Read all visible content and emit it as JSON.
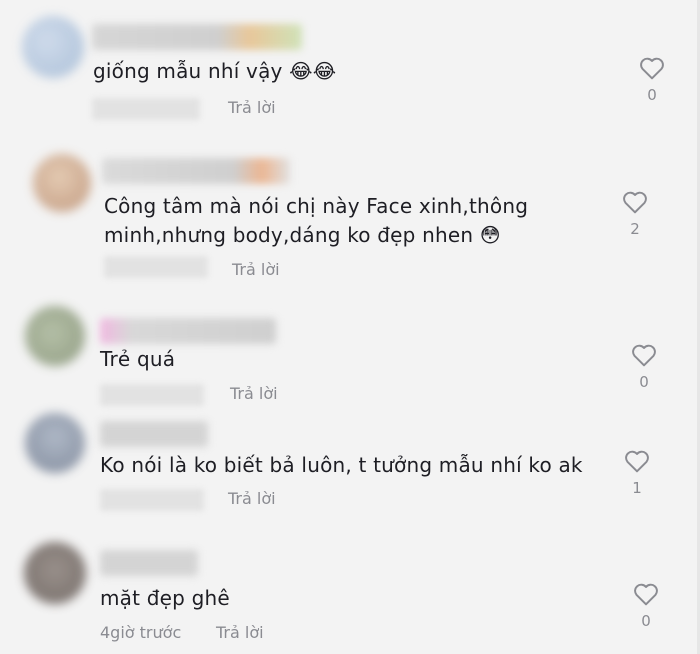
{
  "comments": [
    {
      "text": "giống mẫu nhí vậy 😂😂",
      "time": "",
      "reply": "Trả lời",
      "likes": "0"
    },
    {
      "text_line1": "Công tâm mà nói chị này Face xinh,thông",
      "text_line2": "minh,nhưng body,dáng ko đẹp nhen 😳",
      "time": "",
      "reply": "Trả lời",
      "likes": "2"
    },
    {
      "text": "Trẻ quá",
      "time": "",
      "reply": "Trả lời",
      "likes": "0"
    },
    {
      "text": "Ko nói là ko biết bả luôn, t tưởng mẫu nhí ko ak",
      "time": "",
      "reply": "Trả lời",
      "likes": "1"
    },
    {
      "text": "mặt đẹp ghê",
      "time": "4giờ trước",
      "reply": "Trả lời",
      "likes": "0"
    }
  ],
  "icons": {
    "like": "heart-outline-icon",
    "avatar": "user-avatar"
  },
  "colors": {
    "background": "#f3f3f3",
    "text": "#1e1e24",
    "muted": "#8a8b91"
  }
}
